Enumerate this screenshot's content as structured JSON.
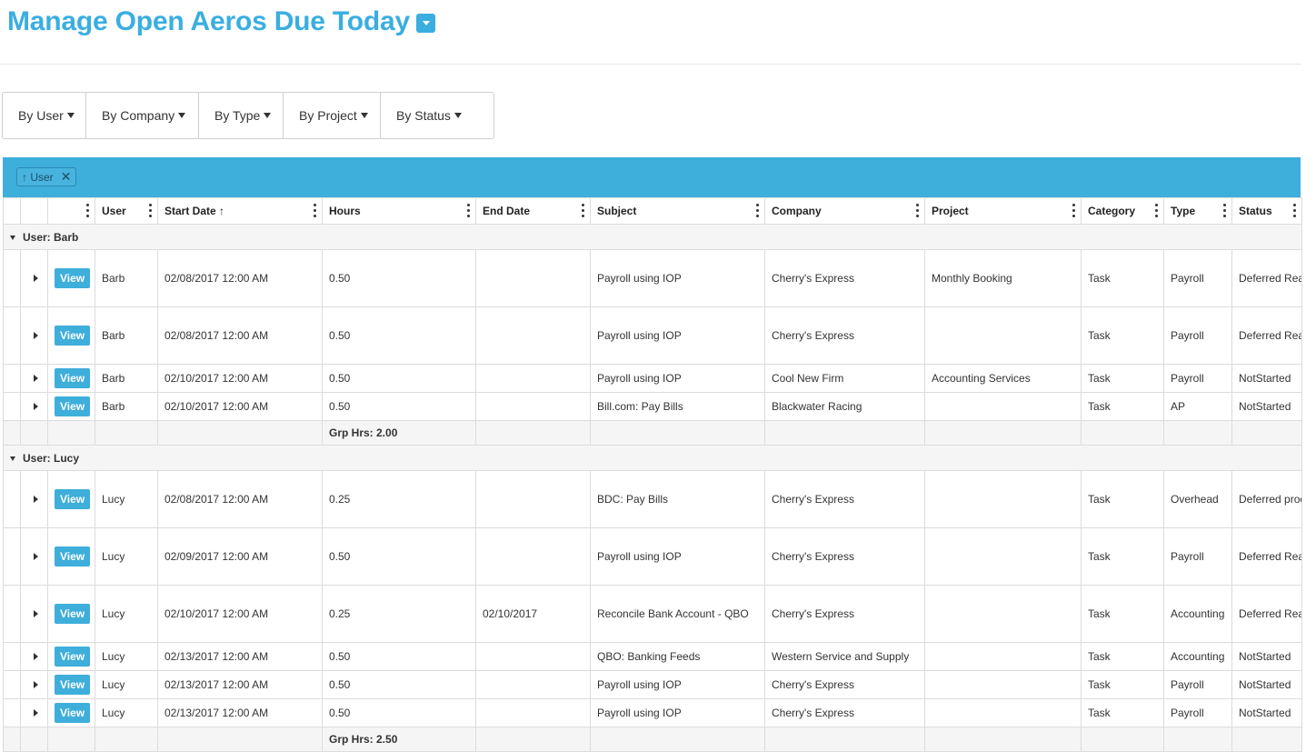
{
  "title": "Manage Open Aeros Due Today",
  "filters": [
    "By User",
    "By Company",
    "By Type",
    "By Project",
    "By Status"
  ],
  "group_chip": {
    "label": "↑ User",
    "close": "✕"
  },
  "columns": [
    {
      "key": "user",
      "label": "User"
    },
    {
      "key": "start",
      "label": "Start Date ↑"
    },
    {
      "key": "hours",
      "label": "Hours"
    },
    {
      "key": "end",
      "label": "End Date"
    },
    {
      "key": "subject",
      "label": "Subject"
    },
    {
      "key": "company",
      "label": "Company"
    },
    {
      "key": "project",
      "label": "Project"
    },
    {
      "key": "category",
      "label": "Category"
    },
    {
      "key": "type",
      "label": "Type"
    },
    {
      "key": "status",
      "label": "Status"
    }
  ],
  "view_label": "View",
  "groups": [
    {
      "label": "User: Barb",
      "footer": "Grp Hrs: 2.00",
      "rows": [
        {
          "user": "Barb",
          "start": "02/08/2017 12:00 AM",
          "hours": "0.50",
          "end": "",
          "subject": "Payroll using IOP",
          "company": "Cherry's Express",
          "project": "Monthly Booking",
          "category": "Task",
          "type": "Payroll",
          "status": "Deferred Ready for reveiw"
        },
        {
          "user": "Barb",
          "start": "02/08/2017 12:00 AM",
          "hours": "0.50",
          "end": "",
          "subject": "Payroll using IOP",
          "company": "Cherry's Express",
          "project": "",
          "category": "Task",
          "type": "Payroll",
          "status": "Deferred Ready for reveiw"
        },
        {
          "user": "Barb",
          "start": "02/10/2017 12:00 AM",
          "hours": "0.50",
          "end": "",
          "subject": "Payroll using IOP",
          "company": "Cool New Firm",
          "project": "Accounting Services",
          "category": "Task",
          "type": "Payroll",
          "status": "NotStarted"
        },
        {
          "user": "Barb",
          "start": "02/10/2017 12:00 AM",
          "hours": "0.50",
          "end": "",
          "subject": "Bill.com: Pay Bills",
          "company": "Blackwater Racing",
          "project": "",
          "category": "Task",
          "type": "AP",
          "status": "NotStarted"
        }
      ]
    },
    {
      "label": "User: Lucy",
      "footer": "Grp Hrs: 2.50",
      "rows": [
        {
          "user": "Lucy",
          "start": "02/08/2017 12:00 AM",
          "hours": "0.25",
          "end": "",
          "subject": "BDC: Pay Bills",
          "company": "Cherry's Express",
          "project": "",
          "category": "Task",
          "type": "Overhead",
          "status": "Deferred processing complete"
        },
        {
          "user": "Lucy",
          "start": "02/09/2017 12:00 AM",
          "hours": "0.50",
          "end": "",
          "subject": "Payroll using IOP",
          "company": "Cherry's Express",
          "project": "",
          "category": "Task",
          "type": "Payroll",
          "status": "Deferred Ready for reveiw"
        },
        {
          "user": "Lucy",
          "start": "02/10/2017 12:00 AM",
          "hours": "0.25",
          "end": "02/10/2017",
          "subject": "Reconcile Bank Account - QBO",
          "company": "Cherry's Express",
          "project": "",
          "category": "Task",
          "type": "Accounting",
          "status": "Deferred Ready for reveiw"
        },
        {
          "user": "Lucy",
          "start": "02/13/2017 12:00 AM",
          "hours": "0.50",
          "end": "",
          "subject": "QBO: Banking Feeds",
          "company": "Western Service and Supply",
          "project": "",
          "category": "Task",
          "type": "Accounting",
          "status": "NotStarted"
        },
        {
          "user": "Lucy",
          "start": "02/13/2017 12:00 AM",
          "hours": "0.50",
          "end": "",
          "subject": "Payroll using IOP",
          "company": "Cherry's Express",
          "project": "",
          "category": "Task",
          "type": "Payroll",
          "status": "NotStarted"
        },
        {
          "user": "Lucy",
          "start": "02/13/2017 12:00 AM",
          "hours": "0.50",
          "end": "",
          "subject": "Payroll using IOP",
          "company": "Cherry's Express",
          "project": "",
          "category": "Task",
          "type": "Payroll",
          "status": "NotStarted"
        }
      ]
    }
  ]
}
